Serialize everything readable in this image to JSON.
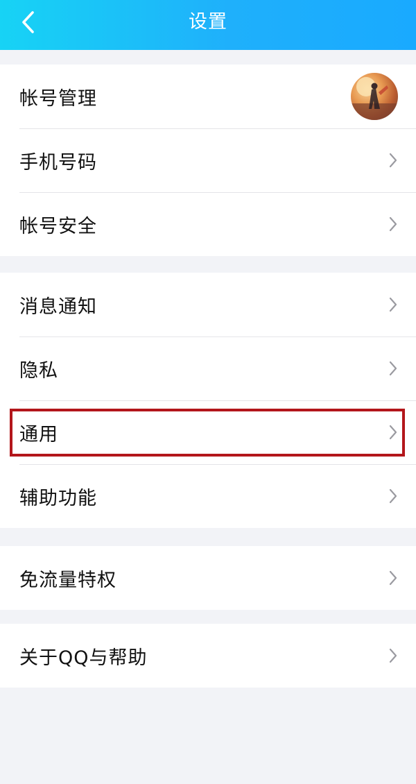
{
  "header": {
    "title": "设置",
    "back_icon": "chevron-left-icon",
    "gradient_colors": [
      "#17d3f5",
      "#19aaff"
    ]
  },
  "groups": [
    {
      "items": [
        {
          "label": "帐号管理",
          "trailing": "avatar"
        },
        {
          "label": "手机号码",
          "trailing": "chevron-right-icon"
        },
        {
          "label": "帐号安全",
          "trailing": "chevron-right-icon"
        }
      ]
    },
    {
      "items": [
        {
          "label": "消息通知",
          "trailing": "chevron-right-icon"
        },
        {
          "label": "隐私",
          "trailing": "chevron-right-icon"
        },
        {
          "label": "通用",
          "trailing": "chevron-right-icon",
          "highlighted": true
        },
        {
          "label": "辅助功能",
          "trailing": "chevron-right-icon"
        }
      ]
    },
    {
      "items": [
        {
          "label": "免流量特权",
          "trailing": "chevron-right-icon"
        }
      ]
    },
    {
      "items": [
        {
          "label": "关于QQ与帮助",
          "trailing": "chevron-right-icon"
        }
      ]
    }
  ],
  "colors": {
    "highlight_border": "#b3161b",
    "background": "#f2f3f7"
  }
}
